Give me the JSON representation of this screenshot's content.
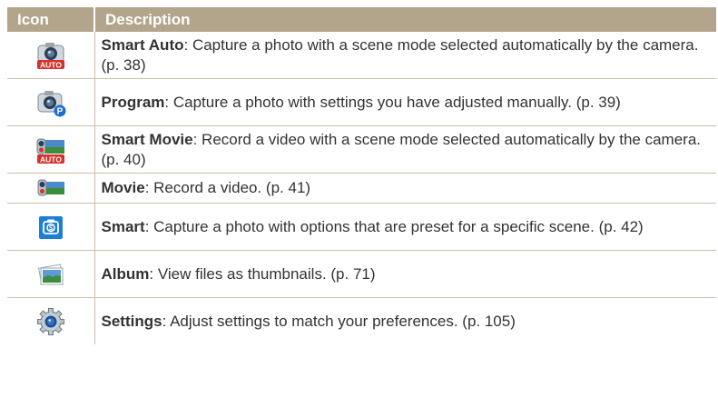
{
  "table": {
    "headers": {
      "icon": "Icon",
      "description": "Description"
    },
    "rows": [
      {
        "icon": "smart-auto-camera-icon",
        "name": "Smart Auto",
        "text": ": Capture a photo with a scene mode selected automatically by the camera. (p. 38)"
      },
      {
        "icon": "program-camera-icon",
        "name": "Program",
        "text": ": Capture a photo with settings you have adjusted manually. (p. 39)"
      },
      {
        "icon": "smart-movie-icon",
        "name": "Smart Movie",
        "text": ": Record a video with a scene mode selected automatically by the camera. (p. 40)"
      },
      {
        "icon": "movie-icon",
        "name": "Movie",
        "text": ": Record a video. (p. 41)"
      },
      {
        "icon": "smart-camera-icon",
        "name": "Smart",
        "text": ": Capture a photo with options that are preset for a specific scene. (p. 42)"
      },
      {
        "icon": "album-icon",
        "name": "Album",
        "text": ": View files as thumbnails. (p. 71)"
      },
      {
        "icon": "settings-gear-icon",
        "name": "Settings",
        "text": ": Adjust settings to match your preferences. (p. 105)"
      }
    ],
    "icon_badges": {
      "auto": "AUTO",
      "program": "P"
    }
  },
  "colors": {
    "header_bg": "#b3a58c",
    "rule": "#cbbfa9",
    "text": "#333333",
    "badge_red": "#d8302a",
    "badge_blue": "#1c6fd1"
  }
}
